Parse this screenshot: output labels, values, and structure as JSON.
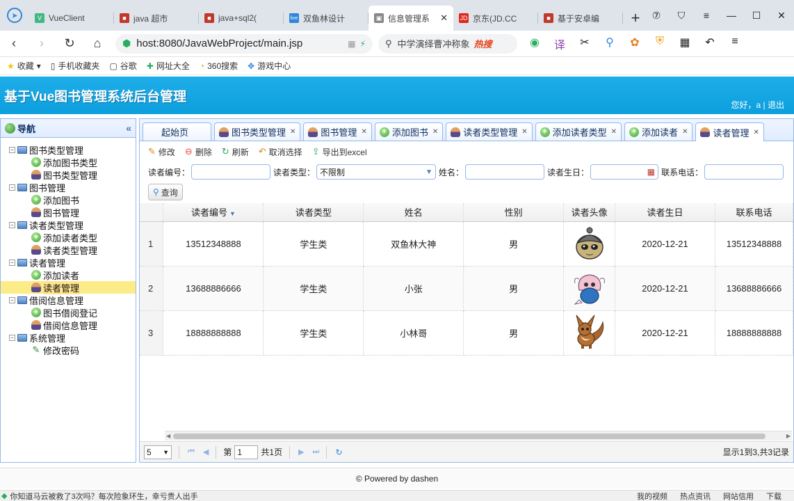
{
  "browser": {
    "tabs": [
      {
        "label": "VueClient",
        "fav": "V",
        "favColor": "#41b883"
      },
      {
        "label": "java 超市",
        "fav": "■",
        "favColor": "#c0392b"
      },
      {
        "label": "java+sql2(",
        "fav": "■",
        "favColor": "#c0392b"
      },
      {
        "label": "双鱼林设计",
        "fav": "live",
        "favColor": "#2e86de"
      },
      {
        "label": "信息管理系",
        "fav": "▣",
        "favColor": "#888888",
        "active": true
      },
      {
        "label": "京东(JD.CC",
        "fav": "JD",
        "favColor": "#e1251b"
      },
      {
        "label": "基于安卓编",
        "fav": "■",
        "favColor": "#c0392b"
      }
    ],
    "url": "host:8080/JavaWebProject/main.jsp",
    "search_text": "中学演绎曹冲称象",
    "search_hot": "热搜"
  },
  "bookmarks": [
    {
      "icon": "★",
      "label": "收藏"
    },
    {
      "icon": "▯",
      "label": "手机收藏夹"
    },
    {
      "icon": "▢",
      "label": "谷歌"
    },
    {
      "icon": "✚",
      "label": "网址大全"
    },
    {
      "icon": "◔",
      "label": "360搜索"
    },
    {
      "icon": "✥",
      "label": "游戏中心"
    }
  ],
  "app": {
    "title": "基于Vue图书管理系统后台管理",
    "user_text": "您好，a | 退出"
  },
  "nav": {
    "title": "导航",
    "tree": [
      {
        "label": "图书类型管理",
        "children": [
          "添加图书类型",
          "图书类型管理"
        ]
      },
      {
        "label": "图书管理",
        "children": [
          "添加图书",
          "图书管理"
        ]
      },
      {
        "label": "读者类型管理",
        "children": [
          "添加读者类型",
          "读者类型管理"
        ]
      },
      {
        "label": "读者管理",
        "children": [
          "添加读者",
          "读者管理"
        ]
      },
      {
        "label": "借阅信息管理",
        "children": [
          "图书借阅登记",
          "借阅信息管理"
        ]
      },
      {
        "label": "系统管理",
        "children": [
          "修改密码"
        ]
      }
    ]
  },
  "tabs": [
    {
      "label": "起始页",
      "icon": "none",
      "closable": false
    },
    {
      "label": "图书类型管理",
      "icon": "user",
      "closable": true
    },
    {
      "label": "图书管理",
      "icon": "user",
      "closable": true
    },
    {
      "label": "添加图书",
      "icon": "add",
      "closable": true
    },
    {
      "label": "读者类型管理",
      "icon": "user",
      "closable": true
    },
    {
      "label": "添加读者类型",
      "icon": "add",
      "closable": true
    },
    {
      "label": "添加读者",
      "icon": "add",
      "closable": true
    },
    {
      "label": "读者管理",
      "icon": "user",
      "closable": true,
      "active": true
    }
  ],
  "toolbar": {
    "edit": "修改",
    "delete": "删除",
    "refresh": "刷新",
    "cancel_select": "取消选择",
    "export": "导出到excel"
  },
  "search": {
    "reader_no_label": "读者编号：",
    "reader_type_label": "读者类型：",
    "reader_type_value": "不限制",
    "name_label": "姓名：",
    "birthday_label": "读者生日：",
    "phone_label": "联系电话：",
    "query_button": "查询"
  },
  "grid": {
    "columns": [
      "读者编号",
      "读者类型",
      "姓名",
      "性别",
      "读者头像",
      "读者生日",
      "联系电话"
    ],
    "rows": [
      {
        "n": "1",
        "no": "13512348888",
        "type": "学生类",
        "name": "双鱼林大神",
        "sex": "男",
        "avatar": "kakuna",
        "birthday": "2020-12-21",
        "phone": "13512348888"
      },
      {
        "n": "2",
        "no": "13688886666",
        "type": "学生类",
        "name": "小张",
        "sex": "男",
        "avatar": "shellos",
        "birthday": "2020-12-21",
        "phone": "13688886666"
      },
      {
        "n": "3",
        "no": "18888888888",
        "type": "学生类",
        "name": "小林哥",
        "sex": "男",
        "avatar": "eevee",
        "birthday": "2020-12-21",
        "phone": "18888888888"
      }
    ]
  },
  "pager": {
    "page_size": "5",
    "page_label": "第",
    "page_value": "1",
    "total_pages": "共1页",
    "info": "显示1到3,共3记录"
  },
  "footer": "© Powered by dashen",
  "statusbar": {
    "news": "你知道马云被救了3次吗？每次险象环生，幸亏贵人出手",
    "items": [
      "我的视频",
      "热点资讯",
      "网站信用",
      "下载"
    ]
  }
}
